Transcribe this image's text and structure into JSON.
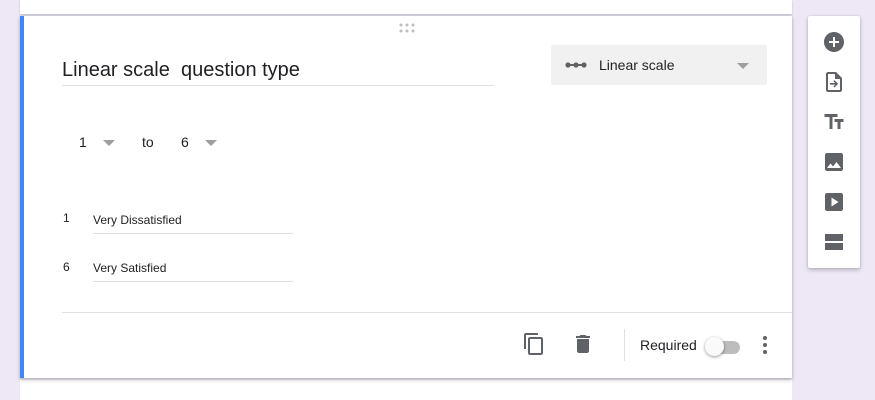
{
  "question": {
    "title": "Linear scale  question type",
    "type_label": "Linear scale"
  },
  "scale": {
    "from_value": "1",
    "to_label": "to",
    "to_value": "6",
    "min_number": "1",
    "min_label": "Very Dissatisfied",
    "max_number": "6",
    "max_label": "Very Satisfied"
  },
  "footer": {
    "required_label": "Required",
    "required_on": false
  },
  "icons": {
    "drag": "drag-handle-icon",
    "type": "linear-scale-icon",
    "copy": "duplicate-icon",
    "delete": "trash-icon",
    "more": "more-vert-icon",
    "add_question": "add-circle-icon",
    "import_questions": "import-icon",
    "add_title": "title-text-icon",
    "add_image": "image-icon",
    "add_video": "video-icon",
    "add_section": "section-icon"
  },
  "colors": {
    "accent": "#4285f4",
    "background": "#ede7f6",
    "icon": "#5f6368"
  }
}
